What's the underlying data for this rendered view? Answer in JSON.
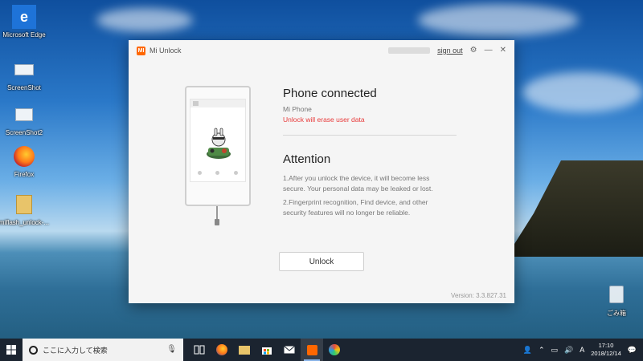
{
  "desktop": {
    "icons": [
      {
        "label": "Microsoft Edge"
      },
      {
        "label": "ScreenShot"
      },
      {
        "label": "ScreenShot2"
      },
      {
        "label": "Firefox"
      },
      {
        "label": "miflash_unlock-..."
      },
      {
        "label": "ごみ箱"
      }
    ]
  },
  "window": {
    "logo_text": "MI",
    "title": "Mi Unlock",
    "sign_out": "sign out",
    "gear": "⚙",
    "minimize": "—",
    "close": "✕",
    "phone_connected": "Phone connected",
    "device_name": "Mi Phone",
    "warning": "Unlock will erase user data",
    "attention_title": "Attention",
    "attention_notes": [
      "1.After you unlock the device, it will become less secure. Your personal data may be leaked or lost.",
      "2.Fingerprint recognition, Find device, and other security features will no longer be reliable."
    ],
    "unlock_button": "Unlock",
    "version": "Version: 3.3.827.31"
  },
  "taskbar": {
    "search_placeholder": "ここに入力して検索",
    "ime_indicator": "A",
    "time": "17:10",
    "date": "2018/12/14"
  },
  "colors": {
    "accent": "#ff6700",
    "warning": "#e83a3a"
  }
}
